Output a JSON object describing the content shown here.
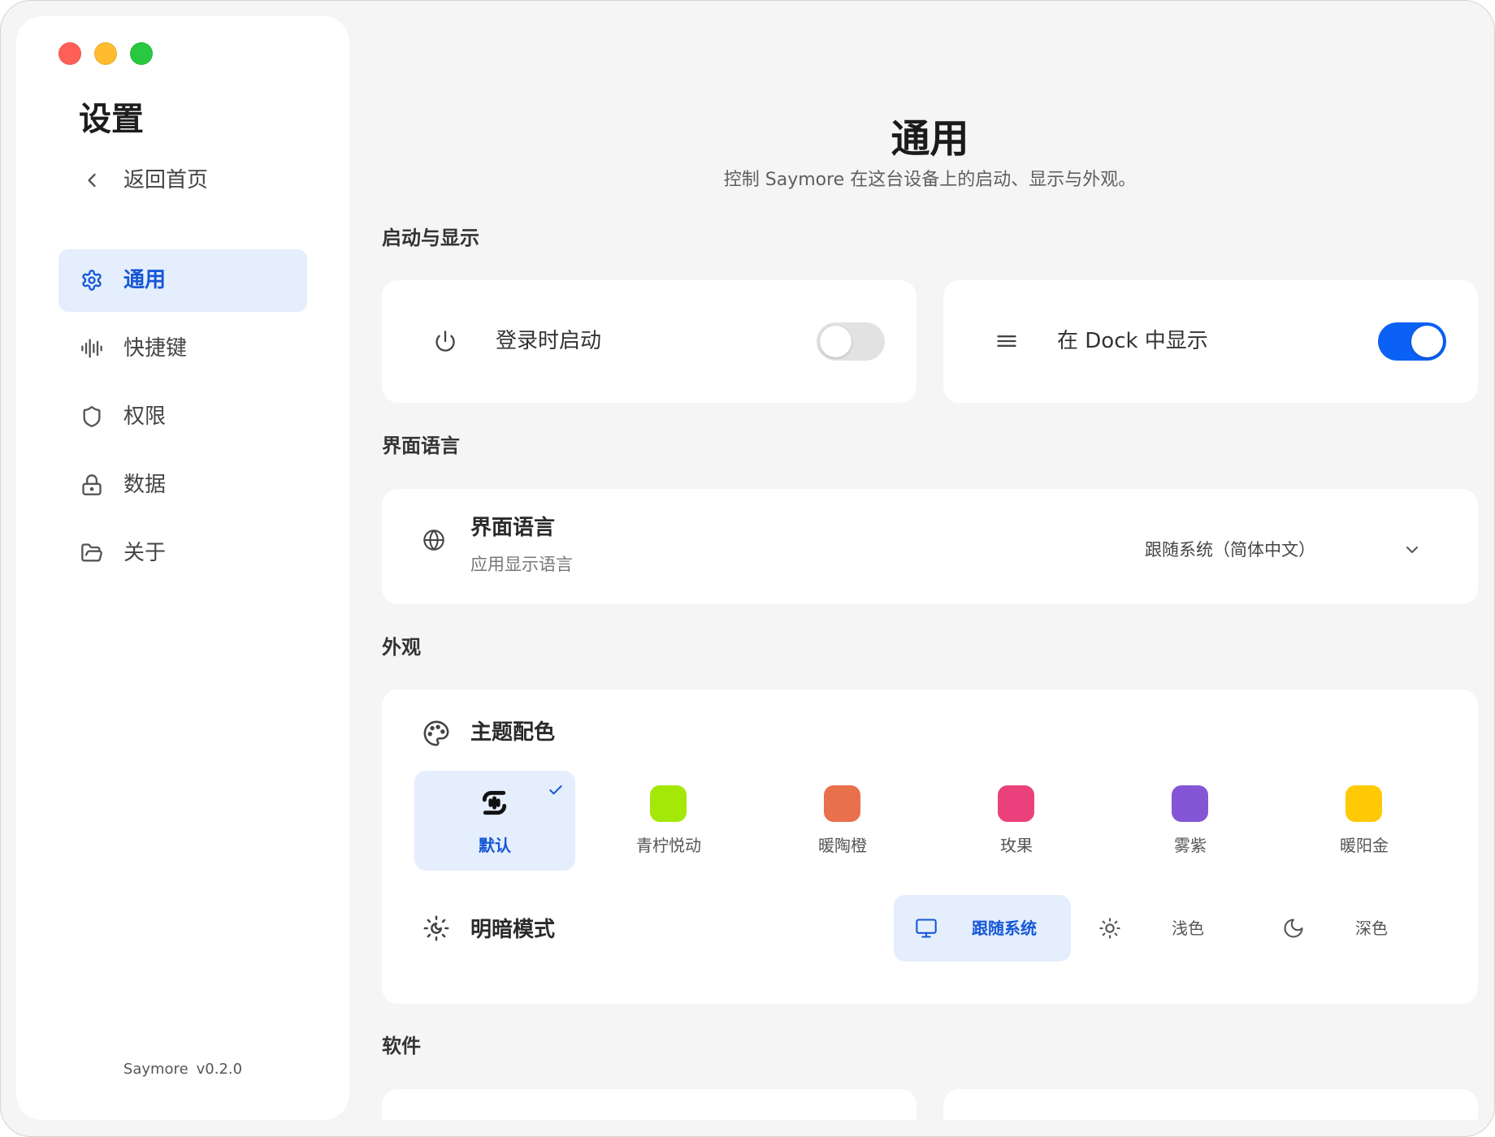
{
  "colors": {
    "accent": "#0b61f5",
    "accent_text": "#1557d6",
    "selected_bg": "#e5eefc",
    "window_bg": "#f5f5f5",
    "card_bg": "#ffffff",
    "traffic_close": "#fe5f57",
    "traffic_minimize": "#febc2e",
    "traffic_zoom": "#28c840"
  },
  "sidebar": {
    "title": "设置",
    "back": {
      "label": "返回首页",
      "icon": "chevron-left-icon"
    },
    "items": [
      {
        "label": "通用",
        "icon": "gear-icon",
        "active": true
      },
      {
        "label": "快捷键",
        "icon": "waveform-icon",
        "active": false
      },
      {
        "label": "权限",
        "icon": "shield-icon",
        "active": false
      },
      {
        "label": "数据",
        "icon": "lock-icon",
        "active": false
      },
      {
        "label": "关于",
        "icon": "folder-open-icon",
        "active": false
      }
    ],
    "footer": {
      "app_name": "Saymore",
      "version": "v0.2.0"
    }
  },
  "main": {
    "title": "通用",
    "subtitle": "控制 Saymore 在这台设备上的启动、显示与外观。",
    "startup": {
      "section_label": "启动与显示",
      "launch_at_login": {
        "label": "登录时启动",
        "icon": "power-icon",
        "enabled": false
      },
      "show_in_dock": {
        "label": "在 Dock 中显示",
        "icon": "menu-icon",
        "enabled": true
      }
    },
    "language": {
      "section_label": "界面语言",
      "title": "界面语言",
      "description": "应用显示语言",
      "icon": "globe-icon",
      "selected": "跟随系统（简体中文）"
    },
    "appearance": {
      "section_label": "外观",
      "theme": {
        "title": "主题配色",
        "icon": "palette-icon",
        "options": [
          {
            "label": "默认",
            "icon": "saymore-logo-icon",
            "selected": true
          },
          {
            "label": "青柠悦动",
            "color": "#a4e808",
            "selected": false
          },
          {
            "label": "暖陶橙",
            "color": "#e8704b",
            "selected": false
          },
          {
            "label": "玫果",
            "color": "#ea417c",
            "selected": false
          },
          {
            "label": "雾紫",
            "color": "#8456d6",
            "selected": false
          },
          {
            "label": "暖阳金",
            "color": "#ffc905",
            "selected": false
          }
        ]
      },
      "mode": {
        "title": "明暗模式",
        "icon": "sun-moon-icon",
        "options": [
          {
            "label": "跟随系统",
            "icon": "monitor-icon",
            "selected": true
          },
          {
            "label": "浅色",
            "icon": "sun-icon",
            "selected": false
          },
          {
            "label": "深色",
            "icon": "moon-icon",
            "selected": false
          }
        ]
      }
    },
    "software": {
      "section_label": "软件"
    }
  }
}
